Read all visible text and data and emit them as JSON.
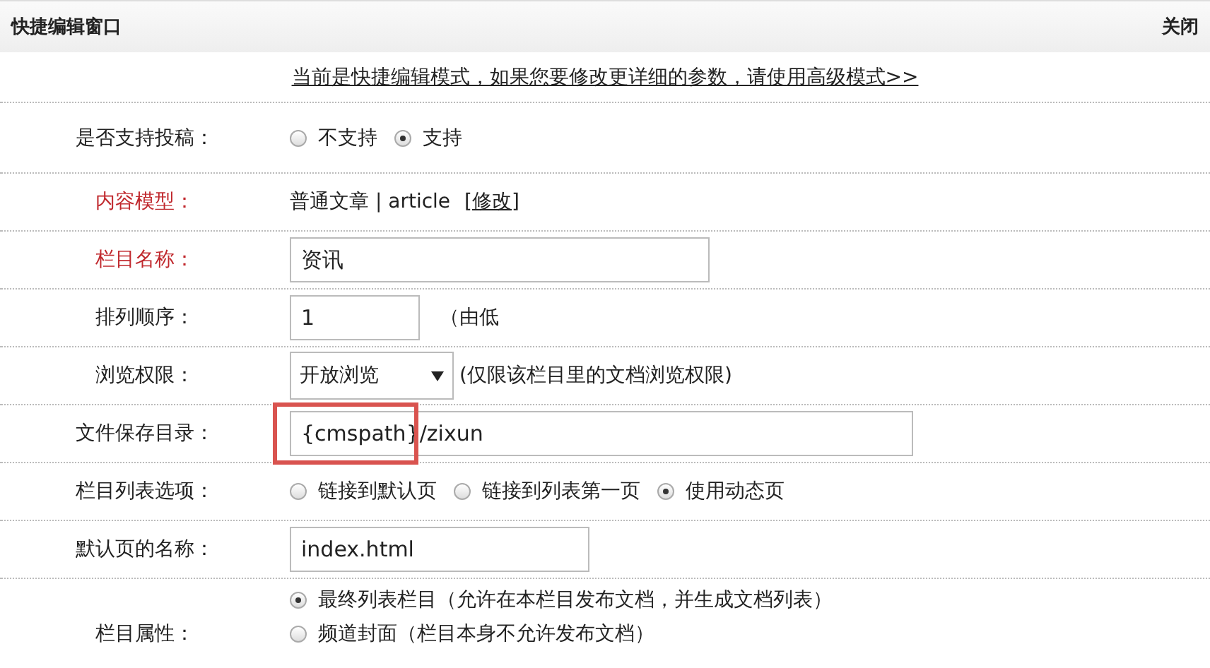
{
  "window": {
    "title": "快捷编辑窗口",
    "close": "关闭"
  },
  "notice": "当前是快捷编辑模式，如果您要修改更详细的参数，请使用高级模式>>",
  "rows": [
    {
      "label": "是否支持投稿：",
      "required": false,
      "kind": "radio",
      "options": [
        {
          "label": "不支持",
          "selected": false
        },
        {
          "label": "支持",
          "selected": true
        }
      ]
    },
    {
      "label": "内容模型：",
      "required": true,
      "kind": "text",
      "text": "普通文章 | article",
      "link": "[修改]"
    },
    {
      "label": "栏目名称：",
      "required": true,
      "kind": "input",
      "value": "资讯"
    },
    {
      "label": "排列顺序：",
      "required": false,
      "kind": "input",
      "value": "1",
      "hint": "（由低"
    },
    {
      "label": "浏览权限：",
      "required": false,
      "kind": "select",
      "value": "开放浏览",
      "hint": "(仅限该栏目里的文档浏览权限)"
    },
    {
      "label": "文件保存目录：",
      "required": false,
      "kind": "input",
      "value": "{cmspath}/zixun",
      "highlighted": true
    },
    {
      "label": "栏目列表选项：",
      "required": false,
      "kind": "radio",
      "options": [
        {
          "label": "链接到默认页",
          "selected": false
        },
        {
          "label": "链接到列表第一页",
          "selected": false
        },
        {
          "label": "使用动态页",
          "selected": true
        }
      ]
    },
    {
      "label": "默认页的名称：",
      "required": false,
      "kind": "input",
      "value": "index.html"
    },
    {
      "label": "栏目属性：",
      "required": false,
      "kind": "radio-stack",
      "options": [
        {
          "label": "最终列表栏目（允许在本栏目发布文档，并生成文档列表）",
          "selected": true
        },
        {
          "label": "频道封面（栏目本身不允许发布文档）",
          "selected": false
        }
      ]
    }
  ]
}
